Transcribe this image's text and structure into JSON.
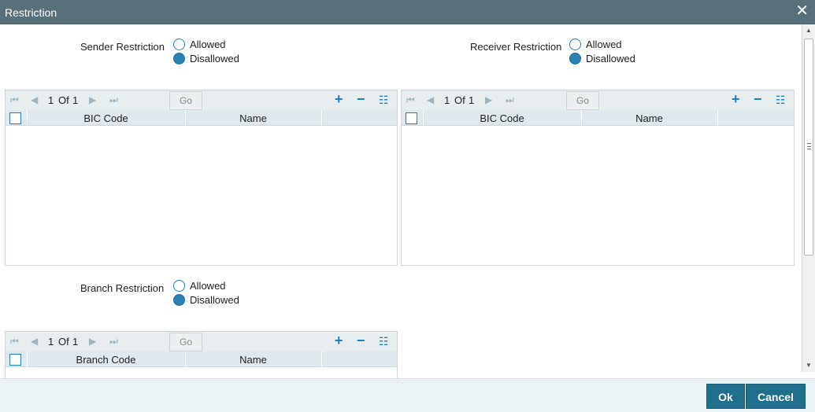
{
  "window": {
    "title": "Restriction",
    "close_glyph": "✕"
  },
  "sender": {
    "label": "Sender Restriction",
    "options": [
      "Allowed",
      "Disallowed"
    ],
    "selected": "Disallowed"
  },
  "receiver": {
    "label": "Receiver Restriction",
    "options": [
      "Allowed",
      "Disallowed"
    ],
    "selected": "Disallowed"
  },
  "branch": {
    "label": "Branch Restriction",
    "options": [
      "Allowed",
      "Disallowed"
    ],
    "selected": "Disallowed"
  },
  "pagination": {
    "current": "1",
    "of_label": "Of",
    "total": "1",
    "go_label": "Go"
  },
  "grids": {
    "sender_grid": {
      "columns": [
        "BIC Code",
        "Name"
      ]
    },
    "receiver_grid": {
      "columns": [
        "BIC Code",
        "Name"
      ]
    },
    "branch_grid": {
      "columns": [
        "Branch Code",
        "Name"
      ]
    }
  },
  "icons": {
    "first": "⏮",
    "prev": "◀",
    "next": "▶",
    "last": "⏭",
    "add": "+",
    "remove": "−",
    "list": "☷",
    "scroll_up": "▲",
    "scroll_down": "▼"
  },
  "footer": {
    "ok_label": "Ok",
    "cancel_label": "Cancel"
  },
  "colors": {
    "title_bar": "#596f79",
    "accent": "#2a7fb3",
    "button": "#1f6f8d"
  }
}
